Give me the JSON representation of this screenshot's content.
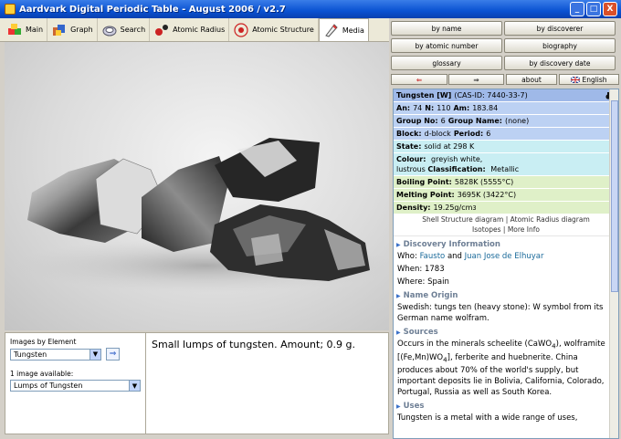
{
  "window": {
    "title": "Aardvark Digital Periodic Table - August 2006 / v2.7",
    "min": "_",
    "max": "□",
    "close": "X"
  },
  "toolbar": {
    "tabs": [
      {
        "label": "Main",
        "icon": "cube-icon"
      },
      {
        "label": "Graph",
        "icon": "graph-icon"
      },
      {
        "label": "Search",
        "icon": "search-icon"
      },
      {
        "label": "Atomic Radius",
        "icon": "atom-radius-icon"
      },
      {
        "label": "Atomic Structure",
        "icon": "atom-structure-icon"
      },
      {
        "label": "Media",
        "icon": "media-icon"
      }
    ]
  },
  "images": {
    "by_element_label": "Images by Element",
    "element_value": "Tungsten",
    "available_label": "1 image available:",
    "image_value": "Lumps of Tungsten",
    "go": "⇒",
    "caption": "Small lumps of tungsten. Amount; 0.9 g."
  },
  "nav": {
    "by_name": "by name",
    "by_discoverer": "by discoverer",
    "by_atomic_number": "by atomic number",
    "biography": "biography",
    "glossary": "glossary",
    "by_discovery_date": "by discovery date",
    "back": "⇐",
    "forward": "⇒",
    "about": "about",
    "language": "English"
  },
  "element": {
    "header": "Tungsten [W]",
    "cas": "(CAS-ID: 7440-33-7)",
    "an_label": "An:",
    "an": "74",
    "n_label": "N:",
    "n": "110",
    "am_label": "Am:",
    "am": "183.84",
    "group_label": "Group No:",
    "group": "6",
    "group_name_label": "Group Name:",
    "group_name": "(none)",
    "block_label": "Block:",
    "block": "d-block",
    "period_label": "Period:",
    "period": "6",
    "state_label": "State:",
    "state": "solid at 298 K",
    "colour_label": "Colour:",
    "colour1": "greyish white,",
    "colour2": "lustrous",
    "class_label": "Classification:",
    "class": "Metallic",
    "boiling_label": "Boiling Point:",
    "boiling": "5828K (5555°C)",
    "melting_label": "Melting Point:",
    "melting": "3695K (3422°C)",
    "density_label": "Density:",
    "density": "19.25g/cm",
    "density_sup": "3",
    "link_shell": "Shell Structure diagram",
    "link_sep": "|",
    "link_radius": "Atomic Radius diagram",
    "link_isotopes": "Isotopes",
    "link_more": "More Info"
  },
  "discovery": {
    "title": "Discovery Information",
    "who_label": "Who:",
    "who1": "Fausto",
    "and": "and",
    "who2": "Juan Jose de Elhuyar",
    "when_label": "When:",
    "when": "1783",
    "where_label": "Where:",
    "where": "Spain"
  },
  "name_origin": {
    "title": "Name Origin",
    "text": "Swedish: tungs ten (heavy stone): W symbol from its German name wolfram."
  },
  "sources": {
    "title": "Sources",
    "t1": "Occurs in the minerals scheelite (CaWO",
    "s1": "4",
    "t2": "),",
    "t3": "wolframite [(Fe,Mn)WO",
    "s2": "4",
    "t4": "], ferberite and",
    "t5": "huebnerite. China produces about 70% of the world's supply, but important deposits lie in Bolivia, California, Colorado, Portugal, Russia as well as South Korea."
  },
  "uses": {
    "title": "Uses",
    "text": "Tungsten is a metal with a wide range of uses,"
  },
  "colors": {
    "header_row": "#9fb9e8",
    "blue_row": "#bcd1f3",
    "cyan_row": "#c9eef3",
    "green_row": "#dff0c8",
    "section_text": "#6e7f95"
  }
}
